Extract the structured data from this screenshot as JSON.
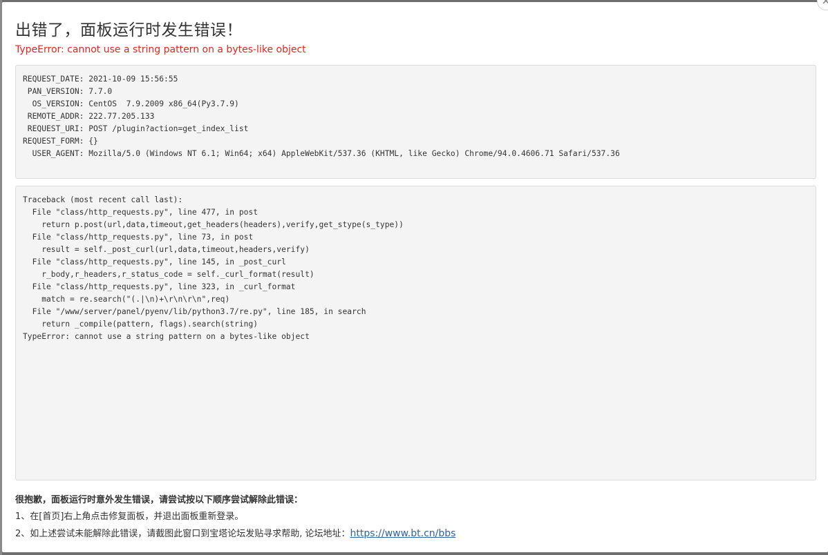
{
  "dialog": {
    "title": "出错了，面板运行时发生错误！",
    "error_message": "TypeError: cannot use a string pattern on a bytes-like object",
    "close_icon": "close-icon"
  },
  "request_info": {
    "lines": [
      "REQUEST_DATE: 2021-10-09 15:56:55",
      " PAN_VERSION: 7.7.0",
      "  OS_VERSION: CentOS  7.9.2009 x86_64(Py3.7.9)",
      " REMOTE_ADDR: 222.77.205.133",
      " REQUEST_URI: POST /plugin?action=get_index_list",
      "REQUEST_FORM: {}",
      "  USER_AGENT: Mozilla/5.0 (Windows NT 6.1; Win64; x64) AppleWebKit/537.36 (KHTML, like Gecko) Chrome/94.0.4606.71 Safari/537.36"
    ]
  },
  "traceback": {
    "lines": [
      "Traceback (most recent call last):",
      "  File \"class/http_requests.py\", line 477, in post",
      "    return p.post(url,data,timeout,get_headers(headers),verify,get_stype(s_type))",
      "  File \"class/http_requests.py\", line 73, in post",
      "    result = self._post_curl(url,data,timeout,headers,verify)",
      "  File \"class/http_requests.py\", line 145, in _post_curl",
      "    r_body,r_headers,r_status_code = self._curl_format(result)",
      "  File \"class/http_requests.py\", line 323, in _curl_format",
      "    match = re.search(\"(.|\\n)+\\r\\n\\r\\n\",req)",
      "  File \"/www/server/panel/pyenv/lib/python3.7/re.py\", line 185, in search",
      "    return _compile(pattern, flags).search(string)",
      "TypeError: cannot use a string pattern on a bytes-like object"
    ]
  },
  "help": {
    "title": "很抱歉，面板运行时意外发生错误，请尝试按以下顺序尝试解除此错误：",
    "step1": "1、在[首页]右上角点击修复面板，并退出面板重新登录。",
    "step2_prefix": "2、如上述尝试未能解除此错误，请截图此窗口到宝塔论坛发贴寻求帮助, 论坛地址：",
    "forum_link": "https://www.bt.cn/bbs"
  },
  "colors": {
    "error_red": "#e8241c",
    "link_blue": "#2b63a8"
  }
}
